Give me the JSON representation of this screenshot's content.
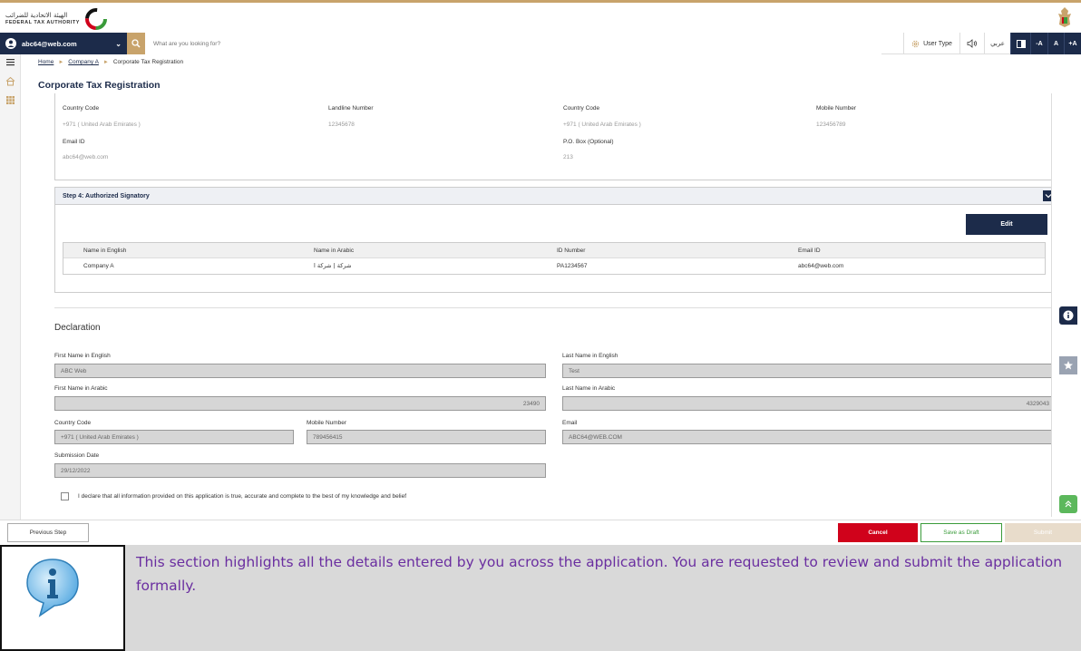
{
  "header": {
    "logo_ar": "الهيئة الاتحادية للضرائب",
    "logo_en": "FEDERAL TAX AUTHORITY"
  },
  "navbar": {
    "user_email": "abc64@web.com",
    "search_placeholder": "What are you looking for?",
    "user_type_label": "User Type",
    "language_label": "عربي",
    "font_decrease": "-A",
    "font_normal": "A",
    "font_increase": "+A"
  },
  "breadcrumb": {
    "items": [
      "Home",
      "Company A",
      "Corporate Tax Registration"
    ]
  },
  "page_title": "Corporate Tax Registration",
  "contact": {
    "country_code_label": "Country Code",
    "country_code_value": "+971 ( United Arab Emirates )",
    "landline_label": "Landline Number",
    "landline_value": "12345678",
    "country_code2_label": "Country Code",
    "country_code2_value": "+971 ( United Arab Emirates )",
    "mobile_label": "Mobile Number",
    "mobile_value": "123456789",
    "email_label": "Email ID",
    "email_value": "abc64@web.com",
    "pobox_label": "P.O. Box (Optional)",
    "pobox_value": "213"
  },
  "step4": {
    "title": "Step 4: Authorized Signatory",
    "edit_label": "Edit",
    "columns": [
      "Name in English",
      "Name in Arabic",
      "ID Number",
      "Email ID"
    ],
    "rows": [
      {
        "name_en": "Company A",
        "name_ar": "شركة | شركة ا",
        "id_number": "PA1234567",
        "email": "abc64@web.com"
      }
    ]
  },
  "declaration": {
    "title": "Declaration",
    "first_name_en_label": "First Name in English",
    "first_name_en_value": "ABC Web",
    "last_name_en_label": "Last Name in English",
    "last_name_en_value": "Test",
    "first_name_ar_label": "First Name in Arabic",
    "first_name_ar_value": "23490",
    "last_name_ar_label": "Last Name in Arabic",
    "last_name_ar_value": "4329043",
    "country_code_label": "Country Code",
    "country_code_value": "+971 ( United Arab Emirates )",
    "mobile_label": "Mobile Number",
    "mobile_value": "789456415",
    "email_label": "Email",
    "email_value": "ABC64@WEB.COM",
    "submission_date_label": "Submission Date",
    "submission_date_value": "29/12/2022",
    "checkbox_label": "I declare that all information provided on this application is true, accurate and complete to the best of my knowledge and belief"
  },
  "footer": {
    "previous_label": "Previous Step",
    "cancel_label": "Cancel",
    "draft_label": "Save as Draft",
    "submit_label": "Submit"
  },
  "info_panel": {
    "text": "This section highlights all the details entered by you across the application. You are requested to review and submit the application formally."
  },
  "colors": {
    "navy": "#1c2b4a",
    "gold": "#c8a36b",
    "cancel_red": "#d0021b",
    "draft_green": "#3a9b3a",
    "submit_disabled": "#e8dccb",
    "info_text": "#6a2ea0"
  }
}
